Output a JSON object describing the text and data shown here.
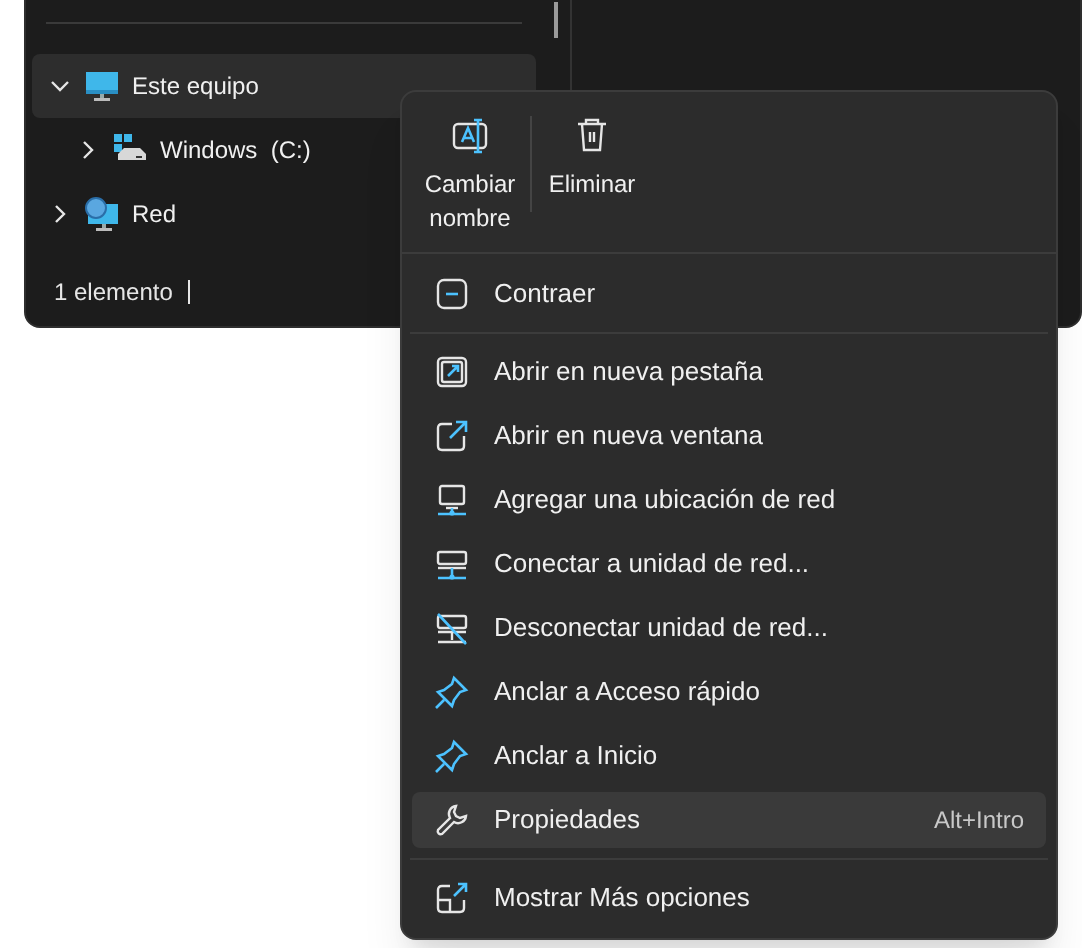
{
  "navigation_pane": {
    "items": [
      {
        "label": "Este equipo",
        "expanded": true,
        "selected": true,
        "children": [
          {
            "label": "Windows  (C:)",
            "expanded": false,
            "selected": false
          }
        ]
      },
      {
        "label": "Red",
        "expanded": false,
        "selected": false
      }
    ]
  },
  "status_bar": {
    "item_count": "1 elemento"
  },
  "context_menu": {
    "commands": [
      {
        "label": "Cambiar nombre"
      },
      {
        "label": "Eliminar"
      }
    ],
    "sections": [
      [
        {
          "label": "Contraer",
          "selected": false
        }
      ],
      [
        {
          "label": "Abrir en nueva pestaña",
          "selected": false
        },
        {
          "label": "Abrir en nueva ventana",
          "selected": false
        },
        {
          "label": "Agregar una ubicación de red",
          "selected": false
        },
        {
          "label": "Conectar a unidad de red...",
          "selected": false
        },
        {
          "label": "Desconectar unidad de red...",
          "selected": false
        },
        {
          "label": "Anclar a Acceso rápido",
          "selected": false
        },
        {
          "label": "Anclar a Inicio",
          "selected": false
        },
        {
          "label": "Propiedades",
          "shortcut": "Alt+Intro",
          "selected": true
        }
      ],
      [
        {
          "label": "Mostrar Más opciones",
          "selected": false
        }
      ]
    ]
  }
}
